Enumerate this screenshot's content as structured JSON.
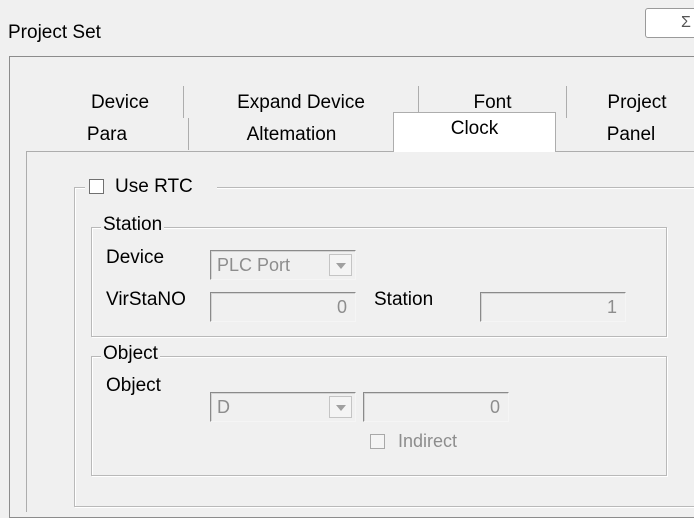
{
  "window": {
    "title": "Project Set",
    "close_glyph": "Σ"
  },
  "tabs": {
    "row1": [
      "Device",
      "Expand Device",
      "Font",
      "Project"
    ],
    "row2": [
      "Para",
      "Altemation",
      "Clock",
      "Panel"
    ],
    "active": "Clock"
  },
  "clock": {
    "use_rtc": {
      "label": "Use RTC",
      "checked": false
    },
    "station": {
      "title": "Station",
      "device_label": "Device",
      "device_value": "PLC Port",
      "virstano_label": "VirStaNO",
      "virstano_value": "0",
      "station_label": "Station",
      "station_value": "1"
    },
    "object": {
      "title": "Object",
      "object_label": "Object",
      "object_value": "D",
      "address_value": "0",
      "indirect_label": "Indirect",
      "indirect_checked": false
    }
  }
}
